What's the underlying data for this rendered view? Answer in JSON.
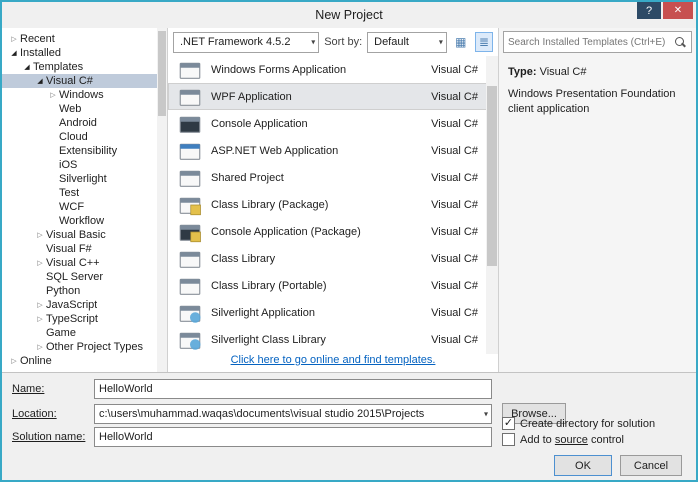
{
  "colors": {
    "window_border": "#38a9c6",
    "close_button_bg": "#c75050",
    "help_button_bg": "#2d4a66",
    "tree_selection_bg": "#bfcbdb",
    "list_selection_bg": "#e4e6e9",
    "link_color": "#0563c1",
    "accent_focus": "#5b9bd5"
  },
  "window": {
    "title": "New Project",
    "help_button": "?",
    "close_button": "✕"
  },
  "toolbar": {
    "framework_selector": ".NET Framework 4.5.2",
    "sort_by_label": "Sort by:",
    "sort_selector": "Default"
  },
  "search": {
    "placeholder": "Search Installed Templates (Ctrl+E)"
  },
  "tree": {
    "items": [
      {
        "label": "Recent",
        "level": 0,
        "expand": "collapsed"
      },
      {
        "label": "Installed",
        "level": 0,
        "expand": "expanded"
      },
      {
        "label": "Templates",
        "level": 1,
        "expand": "expanded"
      },
      {
        "label": "Visual C#",
        "level": 2,
        "expand": "expanded",
        "selected": true
      },
      {
        "label": "Windows",
        "level": 3,
        "expand": "collapsed"
      },
      {
        "label": "Web",
        "level": 3
      },
      {
        "label": "Android",
        "level": 3
      },
      {
        "label": "Cloud",
        "level": 3
      },
      {
        "label": "Extensibility",
        "level": 3
      },
      {
        "label": "iOS",
        "level": 3
      },
      {
        "label": "Silverlight",
        "level": 3
      },
      {
        "label": "Test",
        "level": 3
      },
      {
        "label": "WCF",
        "level": 3
      },
      {
        "label": "Workflow",
        "level": 3
      },
      {
        "label": "Visual Basic",
        "level": 2,
        "expand": "collapsed"
      },
      {
        "label": "Visual F#",
        "level": 2
      },
      {
        "label": "Visual C++",
        "level": 2,
        "expand": "collapsed"
      },
      {
        "label": "SQL Server",
        "level": 2
      },
      {
        "label": "Python",
        "level": 2
      },
      {
        "label": "JavaScript",
        "level": 2,
        "expand": "collapsed"
      },
      {
        "label": "TypeScript",
        "level": 2,
        "expand": "collapsed"
      },
      {
        "label": "Game",
        "level": 2
      },
      {
        "label": "Other Project Types",
        "level": 2,
        "expand": "collapsed"
      },
      {
        "label": "Online",
        "level": 0,
        "expand": "collapsed"
      }
    ]
  },
  "templates": {
    "items": [
      {
        "name": "Windows Forms Application",
        "lang": "Visual C#",
        "icon": "windows-forms-app-icon"
      },
      {
        "name": "WPF Application",
        "lang": "Visual C#",
        "icon": "wpf-app-icon",
        "selected": true
      },
      {
        "name": "Console Application",
        "lang": "Visual C#",
        "icon": "console-app-icon"
      },
      {
        "name": "ASP.NET Web Application",
        "lang": "Visual C#",
        "icon": "aspnet-web-app-icon"
      },
      {
        "name": "Shared Project",
        "lang": "Visual C#",
        "icon": "shared-project-icon"
      },
      {
        "name": "Class Library (Package)",
        "lang": "Visual C#",
        "icon": "class-library-package-icon"
      },
      {
        "name": "Console Application (Package)",
        "lang": "Visual C#",
        "icon": "console-app-package-icon"
      },
      {
        "name": "Class Library",
        "lang": "Visual C#",
        "icon": "class-library-icon"
      },
      {
        "name": "Class Library (Portable)",
        "lang": "Visual C#",
        "icon": "class-library-portable-icon"
      },
      {
        "name": "Silverlight Application",
        "lang": "Visual C#",
        "icon": "silverlight-app-icon"
      },
      {
        "name": "Silverlight Class Library",
        "lang": "Visual C#",
        "icon": "silverlight-class-library-icon"
      }
    ],
    "online_link": "Click here to go online and find templates."
  },
  "details": {
    "type_label": "Type:",
    "type_value": "Visual C#",
    "description": "Windows Presentation Foundation client application"
  },
  "form": {
    "name_label": "Name:",
    "name_value": "HelloWorld",
    "location_label": "Location:",
    "location_value": "c:\\users\\muhammad.waqas\\documents\\visual studio 2015\\Projects",
    "browse_button": "Browse...",
    "solution_label": "Solution name:",
    "solution_value": "HelloWorld",
    "create_dir_label": "Create directory for solution",
    "create_dir_checked": true,
    "source_prefix": "Add to ",
    "source_underlined": "source",
    "source_suffix": " control",
    "source_control_checked": false
  },
  "footer": {
    "ok_button": "OK",
    "cancel_button": "Cancel"
  }
}
